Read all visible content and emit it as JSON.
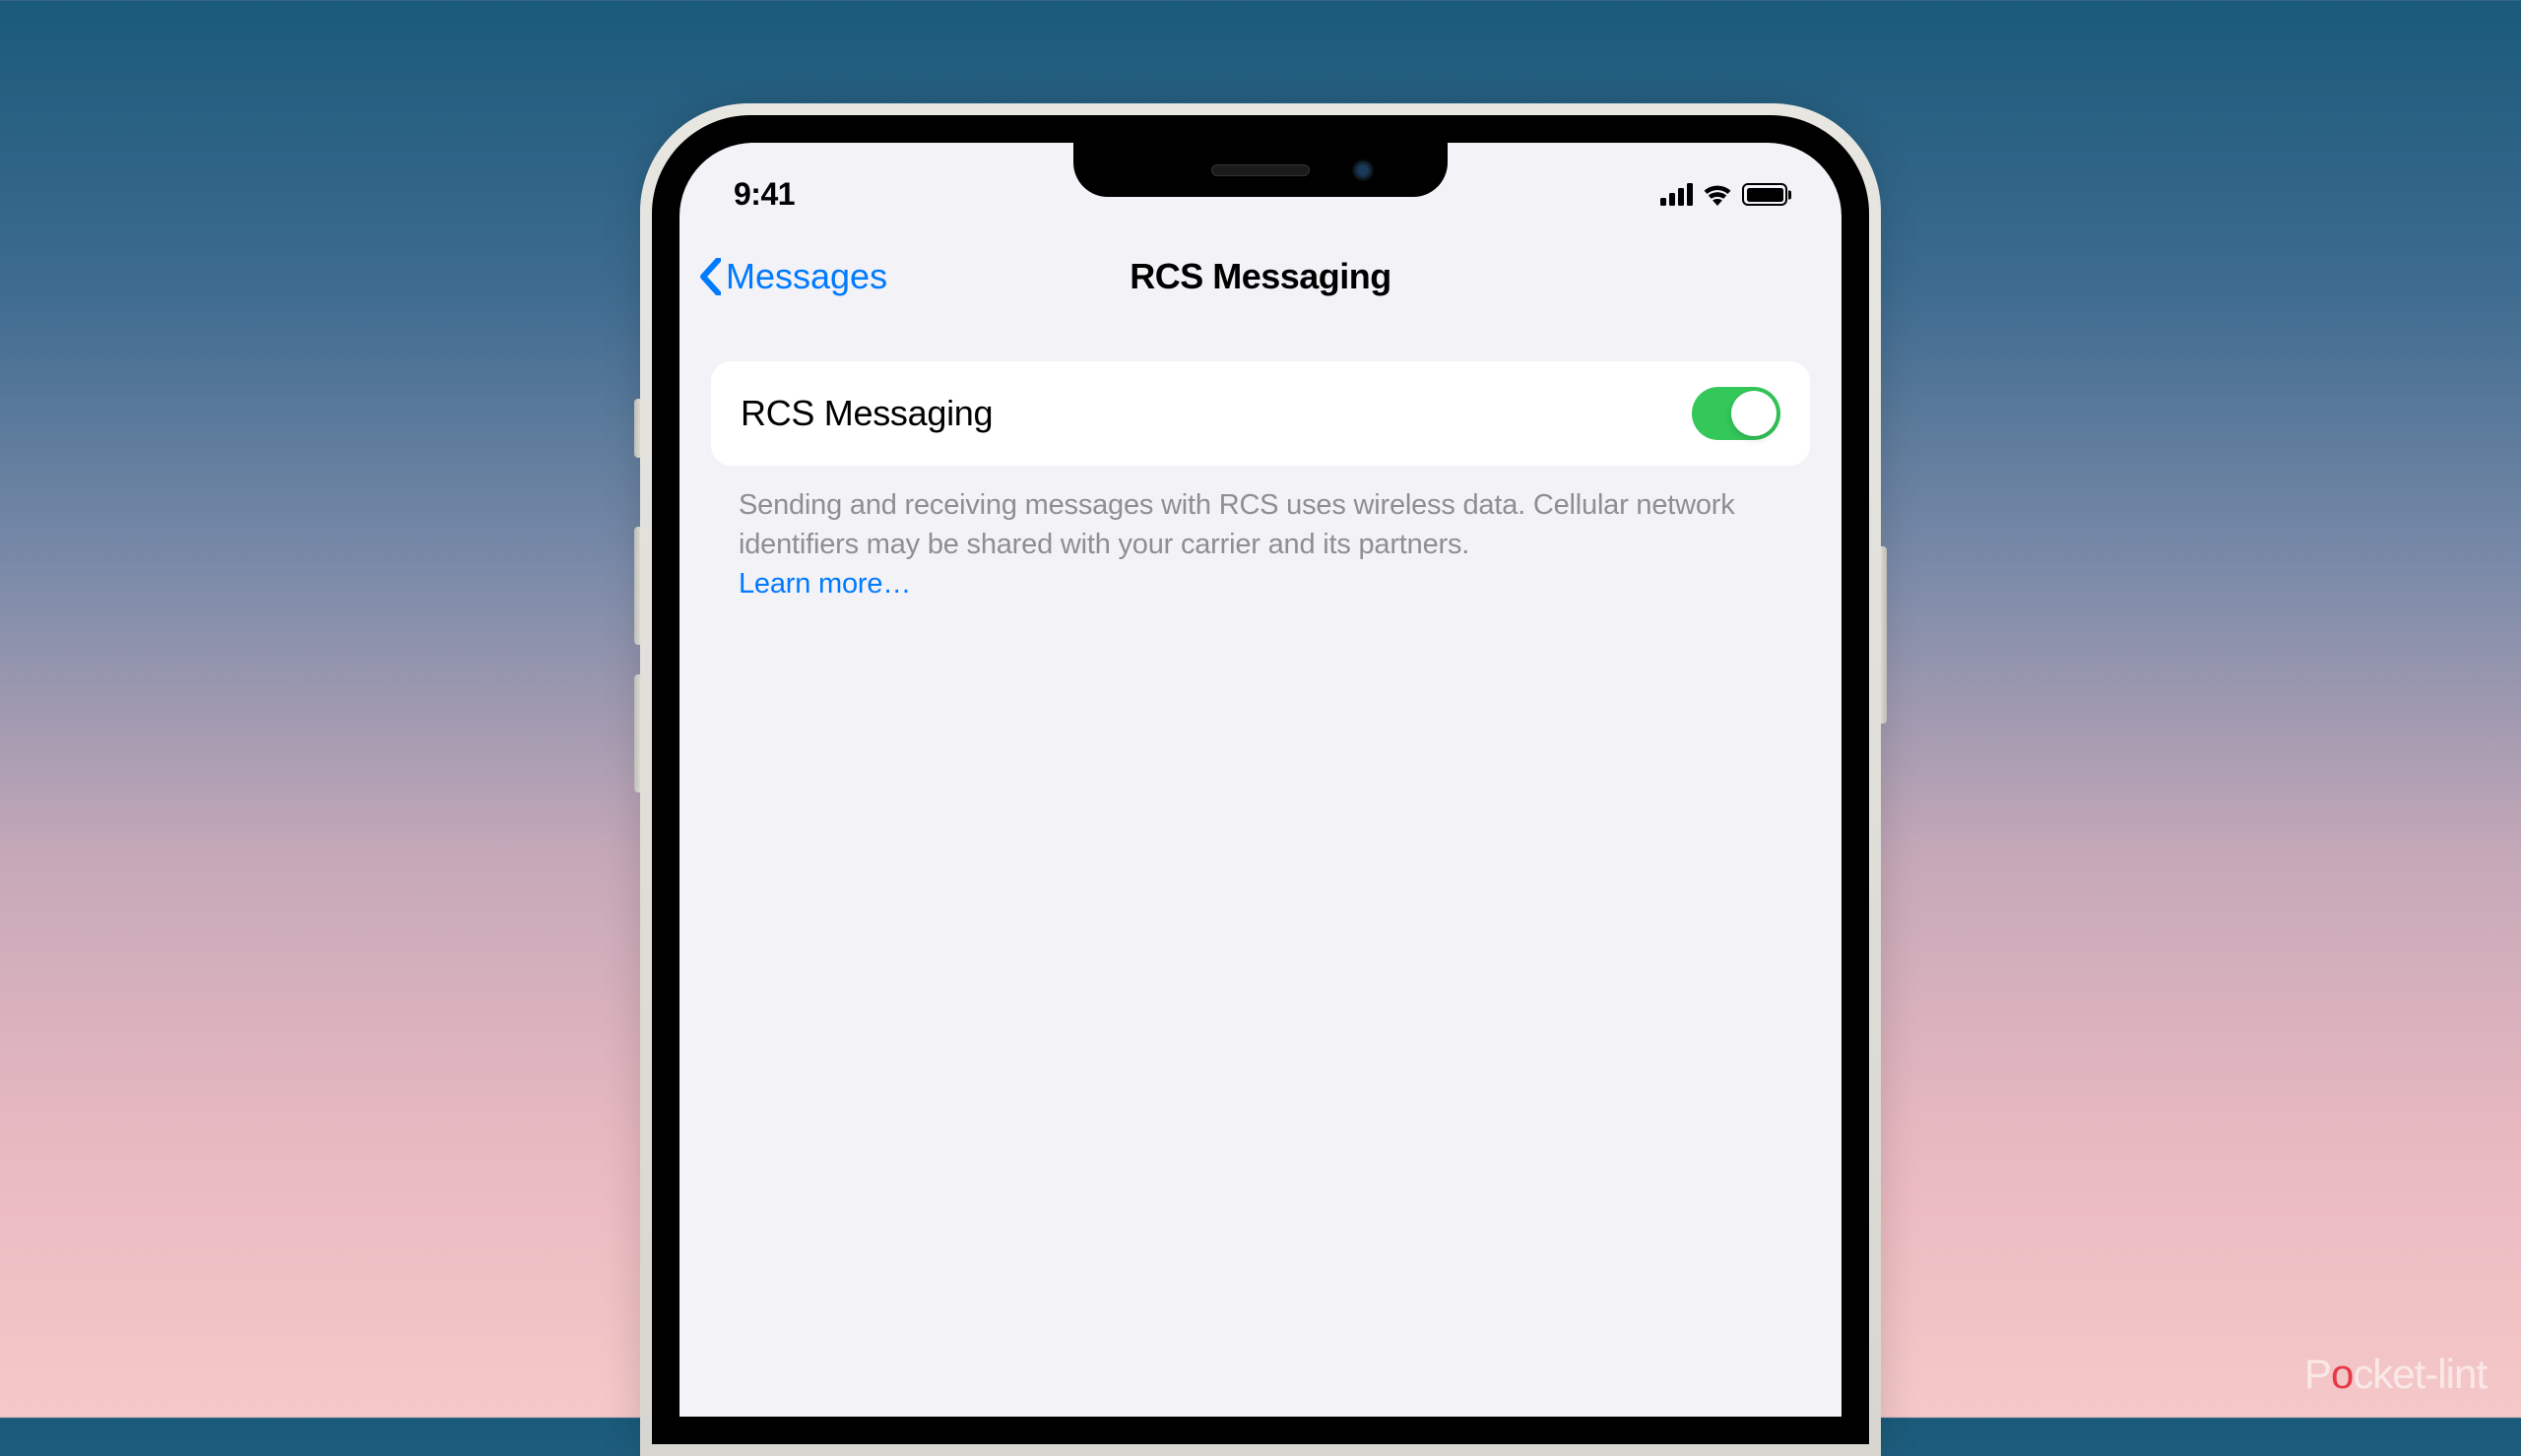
{
  "statusBar": {
    "time": "9:41"
  },
  "navBar": {
    "backLabel": "Messages",
    "title": "RCS Messaging"
  },
  "settings": {
    "toggleLabel": "RCS Messaging",
    "toggleOn": true,
    "description": "Sending and receiving messages with RCS uses wireless data. Cellular network identifiers may be shared with your carrier and its partners.",
    "learnMore": "Learn more…"
  },
  "watermark": {
    "prefix": "P",
    "power": "o",
    "suffix": "cket-lint"
  }
}
